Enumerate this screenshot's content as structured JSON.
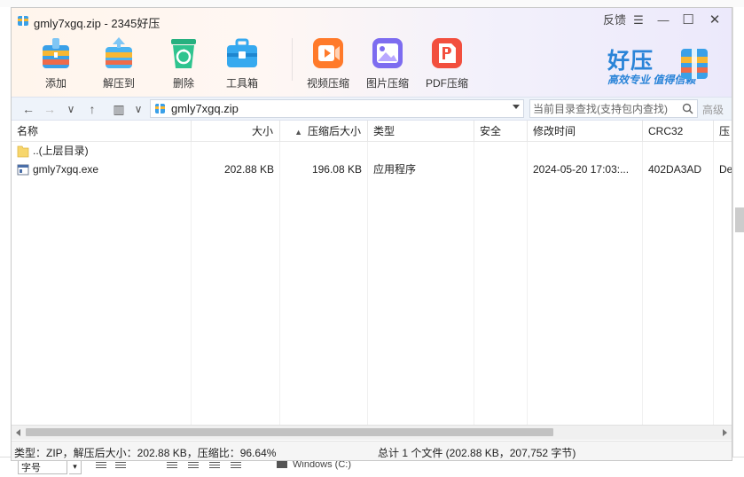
{
  "window": {
    "title": "gmly7xgq.zip - 2345好压",
    "feedback": "反馈",
    "menu_glyph": "☰",
    "minimize_glyph": "—",
    "maximize_glyph": "☐",
    "close_glyph": "✕"
  },
  "toolbar": {
    "add": "添加",
    "extract_to": "解压到",
    "delete": "删除",
    "toolbox": "工具箱",
    "video_compress": "视频压缩",
    "image_compress": "图片压缩",
    "pdf_compress": "PDF压缩"
  },
  "brand": {
    "name": "好压",
    "slogan": "高效专业 值得信赖"
  },
  "navbar": {
    "back_glyph": "←",
    "forward_glyph": "→",
    "history_glyph": "∨",
    "up_glyph": "↑",
    "view_glyph": "▥",
    "view_dd_glyph": "∨",
    "path": "gmly7xgq.zip",
    "search_placeholder": "当前目录查找(支持包内查找)",
    "more": "高级"
  },
  "table": {
    "headers": {
      "name": "名称",
      "size": "大小",
      "packed": "压缩后大小",
      "type": "类型",
      "security": "安全",
      "modified": "修改时间",
      "crc": "CRC32",
      "ratio": "压"
    },
    "sort_glyph": "▲",
    "rows": [
      {
        "name": "..(上层目录)",
        "size": "",
        "packed": "",
        "type": "",
        "security": "",
        "modified": "",
        "crc": "",
        "ratio": ""
      },
      {
        "name": "gmly7xgq.exe",
        "size": "202.88 KB",
        "packed": "196.08 KB",
        "type": "应用程序",
        "security": "",
        "modified": "2024-05-20 17:03:...",
        "crc": "402DA3AD",
        "ratio": "De"
      }
    ]
  },
  "status": {
    "left": "类型：ZIP，解压后大小：202.88 KB，压缩比：96.64%",
    "right": "总计 1 个文件 (202.88 KB，207,752 字节)"
  },
  "background": {
    "font_field": "字号",
    "dd_glyph": "▾",
    "drive_label": "Windows (C:)"
  },
  "colors": {
    "accent": "#2a84d8",
    "add_icon": "#3aa0e8",
    "extract_icon": "#4bb3f0",
    "delete_icon": "#2fc48f",
    "toolbox_icon": "#36a9ef",
    "video_icon": "#ff7a2a",
    "image_icon": "#7d6cf0",
    "pdf_icon": "#f24f3e",
    "folder": "#f7d66c"
  }
}
